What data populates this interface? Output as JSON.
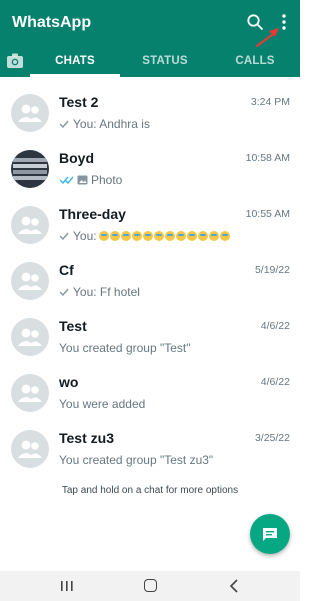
{
  "header": {
    "title": "WhatsApp",
    "brand_color": "#06816d",
    "icons": [
      "search-icon",
      "more-options-icon",
      "camera-icon"
    ]
  },
  "tabs": [
    {
      "label": "CHATS",
      "active": true
    },
    {
      "label": "STATUS",
      "active": false
    },
    {
      "label": "CALLS",
      "active": false
    }
  ],
  "chats": [
    {
      "name": "Test 2",
      "time": "3:24 PM",
      "tick": "single",
      "preview": "You: Andhra is",
      "avatar": "group"
    },
    {
      "name": "Boyd",
      "time": "10:58 AM",
      "tick": "double-blue",
      "preview": "Photo",
      "avatar": "photo"
    },
    {
      "name": "Three-day",
      "time": "10:55 AM",
      "tick": "single",
      "preview": "You:",
      "emoji_count": 12,
      "avatar": "group"
    },
    {
      "name": "Cf",
      "time": "5/19/22",
      "tick": "single",
      "preview": "You: Ff hotel",
      "avatar": "group"
    },
    {
      "name": "Test",
      "time": "4/6/22",
      "tick": "none",
      "preview": "You created group \"Test\"",
      "avatar": "group"
    },
    {
      "name": "wo",
      "time": "4/6/22",
      "tick": "none",
      "preview": "You were added",
      "avatar": "group"
    },
    {
      "name": "Test zu3",
      "time": "3/25/22",
      "tick": "none",
      "preview": "You created group \"Test zu3\"",
      "avatar": "group"
    }
  ],
  "hint": "Tap and hold on a chat for more options",
  "fab_icon": "new-chat-icon",
  "accent_color": "#06a884"
}
